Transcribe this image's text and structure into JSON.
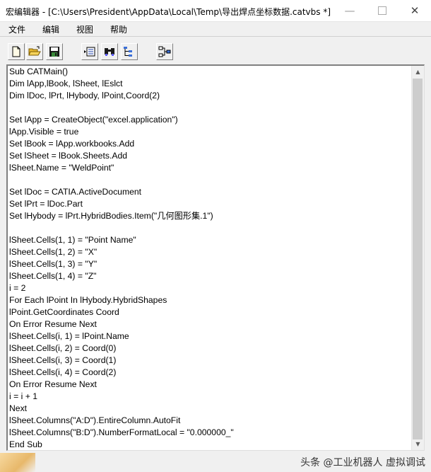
{
  "window": {
    "title": "宏编辑器 - [C:\\Users\\President\\AppData\\Local\\Temp\\导出焊点坐标数据.catvbs *]",
    "minimize_label": "—",
    "close_label": "✕"
  },
  "menu": [
    {
      "label": "文件"
    },
    {
      "label": "编辑"
    },
    {
      "label": "视图"
    },
    {
      "label": "帮助"
    }
  ],
  "toolbar": [
    {
      "icon": "new-file-icon"
    },
    {
      "icon": "open-folder-icon"
    },
    {
      "icon": "save-disk-icon"
    },
    {
      "icon": "object-browser-icon"
    },
    {
      "icon": "find-binoculars-icon"
    },
    {
      "icon": "tree-view-icon"
    },
    {
      "icon": "hierarchy-icon"
    }
  ],
  "code_lines": [
    "Sub CATMain()",
    "Dim lApp,lBook, lSheet, lEslct",
    "Dim lDoc, lPrt, lHybody, lPoint,Coord(2)",
    "",
    "Set lApp = CreateObject(\"excel.application\")",
    "lApp.Visible = true",
    "Set lBook = lApp.workbooks.Add",
    "Set lSheet = lBook.Sheets.Add",
    "lSheet.Name = \"WeldPoint\"",
    "",
    "Set lDoc = CATIA.ActiveDocument",
    "Set lPrt = lDoc.Part",
    "Set lHybody = lPrt.HybridBodies.Item(\"几何图形集.1\")",
    "",
    "lSheet.Cells(1, 1) = \"Point Name\"",
    "lSheet.Cells(1, 2) = \"X\"",
    "lSheet.Cells(1, 3) = \"Y\"",
    "lSheet.Cells(1, 4) = \"Z\"",
    "i = 2",
    "For Each lPoint In lHybody.HybridShapes",
    "lPoint.GetCoordinates Coord",
    "On Error Resume Next",
    "lSheet.Cells(i, 1) = lPoint.Name",
    "lSheet.Cells(i, 2) = Coord(0)",
    "lSheet.Cells(i, 3) = Coord(1)",
    "lSheet.Cells(i, 4) = Coord(2)",
    "On Error Resume Next",
    "i = i + 1",
    "Next",
    "lSheet.Columns(\"A:D\").EntireColumn.AutoFit",
    "lSheet.Columns(\"B:D\").NumberFormatLocal = \"0.000000_\"",
    "End Sub"
  ],
  "watermark": "头条 @工业机器人 虚拟调试"
}
